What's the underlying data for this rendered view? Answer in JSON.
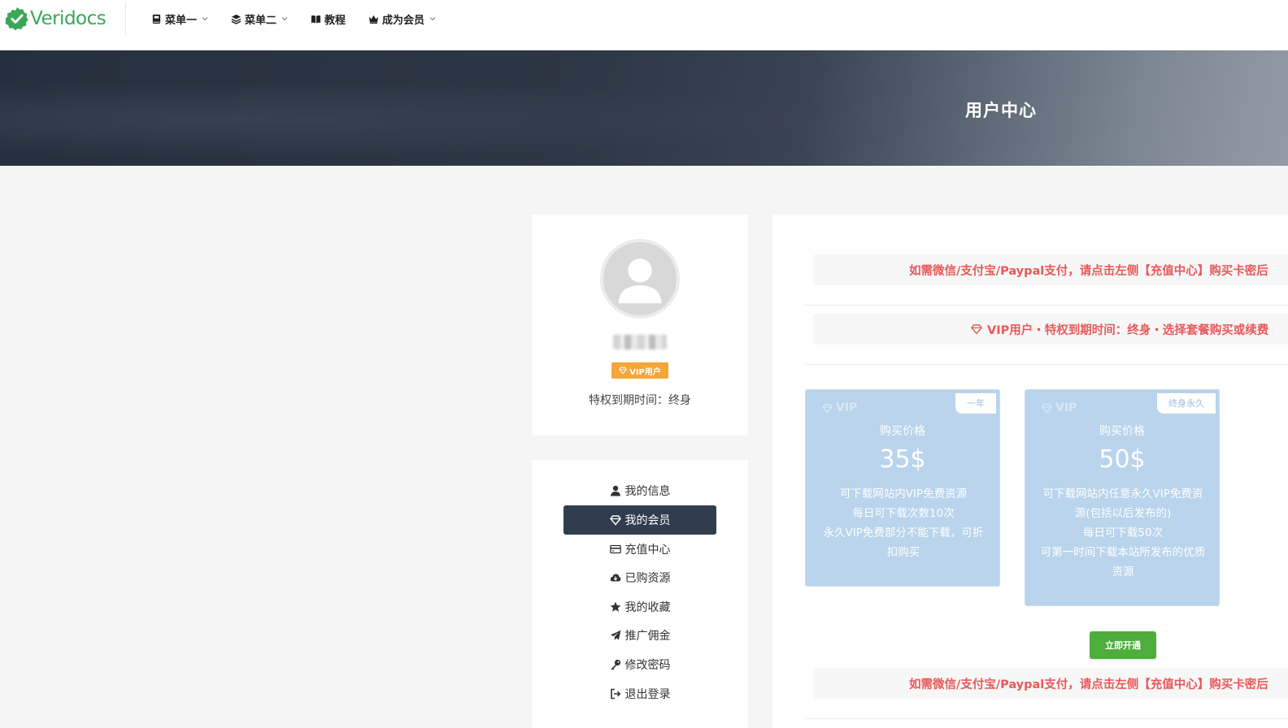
{
  "header": {
    "logo_text": "Veridocs",
    "nav": [
      {
        "label": "菜单一",
        "icon": "book-icon",
        "dropdown": true
      },
      {
        "label": "菜单二",
        "icon": "layers-icon",
        "dropdown": true
      },
      {
        "label": "教程",
        "icon": "open-book-icon",
        "dropdown": false
      },
      {
        "label": "成为会员",
        "icon": "crown-icon",
        "dropdown": true
      }
    ]
  },
  "hero": {
    "title": "用户中心"
  },
  "profile": {
    "vip_badge": "VIP用户",
    "expire_text": "特权到期时间：终身"
  },
  "menu": {
    "items": [
      {
        "label": "我的信息",
        "icon": "user-icon"
      },
      {
        "label": "我的会员",
        "icon": "diamond-icon",
        "active": true
      },
      {
        "label": "充值中心",
        "icon": "credit-card-icon"
      },
      {
        "label": "已购资源",
        "icon": "cloud-download-icon"
      },
      {
        "label": "我的收藏",
        "icon": "star-icon"
      },
      {
        "label": "推广佣金",
        "icon": "paper-plane-icon"
      },
      {
        "label": "修改密码",
        "icon": "key-icon"
      },
      {
        "label": "退出登录",
        "icon": "sign-out-icon"
      }
    ]
  },
  "content": {
    "notice_top": "如需微信/支付宝/Paypal支付，请点击左侧【充值中心】购买卡密后",
    "vip_status": "VIP用户・特权到期时间：终身・选择套餐购买或续费",
    "plans": [
      {
        "vip": "VIP",
        "tag": "一年",
        "label": "购买价格",
        "price": "35$",
        "desc": [
          "可下载网站内VIP免费资源",
          "每日可下载次数10次",
          "永久VIP免费部分不能下载，可折扣购买"
        ]
      },
      {
        "vip": "VIP",
        "tag": "终身永久",
        "label": "购买价格",
        "price": "50$",
        "desc": [
          "可下载网站内任意永久VIP免费资源(包括以后发布的)",
          "每日可下载50次",
          "可第一时间下载本站所发布的优质资源"
        ]
      }
    ],
    "open_button": "立即开通",
    "notice_bottom": "如需微信/支付宝/Paypal支付，请点击左侧【充值中心】购买卡密后"
  },
  "colors": {
    "brand_green": "#3aa757",
    "accent_red": "#e8595b",
    "menu_active": "#2f3d4e",
    "vip_orange": "#f3a63a",
    "plan_blue": "#b9d4ec",
    "button_green": "#4fad3c"
  }
}
